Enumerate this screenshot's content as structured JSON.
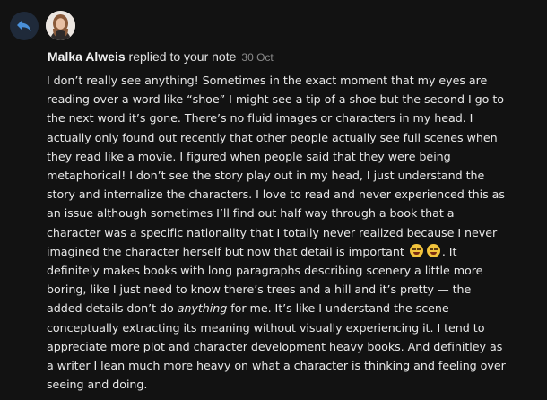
{
  "notification": {
    "author": "Malka Alweis",
    "action": " replied to your note",
    "date": "30 Oct",
    "icons": {
      "reply": "reply-arrow-icon",
      "emoji": "rolling-on-floor-laughing-emoji"
    },
    "accent_color": "#4a90d9",
    "body_part1": "I don’t really see anything! Sometimes in the exact moment that my eyes are reading over a word like “shoe” I might see a tip of a shoe but the second I go to the next word it’s gone. There’s no fluid images or characters in my head. I actually only found out recently that other people actually see full scenes when they read like a movie. I figured when people said that they were being metaphorical! I don’t see the story play out in my head, I just understand the story and internalize the characters. I love to read and never experienced this as an issue although sometimes I’ll find out half way through a book that a character was a specific nationality that I totally never realized because I never imagined the character herself but now that detail is important ",
    "body_part2": ". It definitely makes books with long paragraphs describing scenery a little more boring, like I just need to know there’s trees and a hill and it’s pretty — the added details don’t do ",
    "body_emphasis": "anything",
    "body_part3": " for me. It’s like I understand the scene conceptually extracting its meaning without visually experiencing it. I tend to appreciate more plot and character development heavy books. And definitley as a writer I lean much more heavy on what a character is thinking and feeling over seeing and doing."
  }
}
